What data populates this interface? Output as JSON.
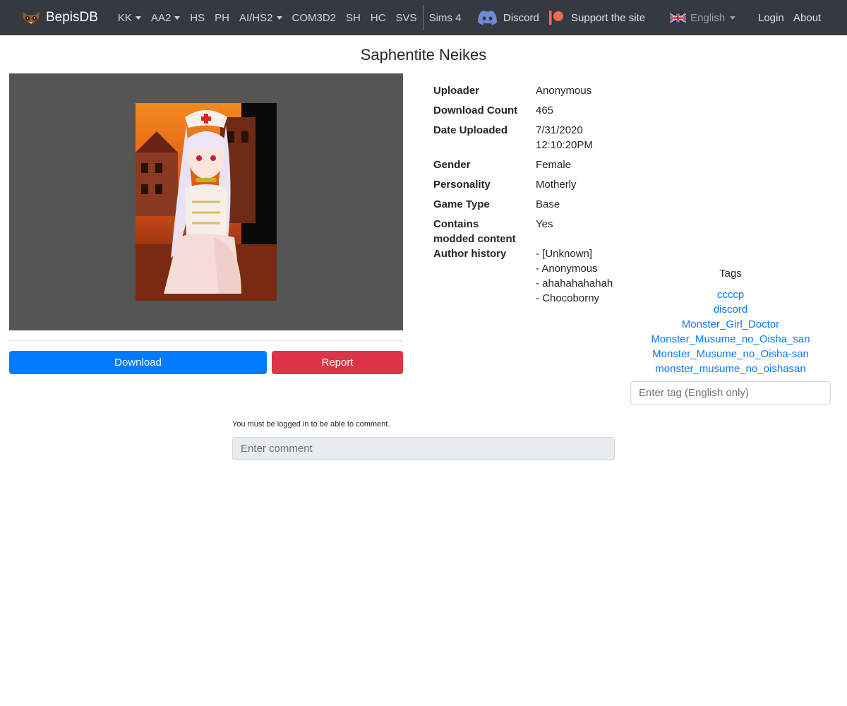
{
  "navbar": {
    "brand": "BepisDB",
    "items": [
      {
        "label": "KK",
        "dropdown": true
      },
      {
        "label": "AA2",
        "dropdown": true
      },
      {
        "label": "HS",
        "dropdown": false
      },
      {
        "label": "PH",
        "dropdown": false
      },
      {
        "label": "AI/HS2",
        "dropdown": true
      },
      {
        "label": "COM3D2",
        "dropdown": false
      },
      {
        "label": "SH",
        "dropdown": false
      },
      {
        "label": "HC",
        "dropdown": false
      },
      {
        "label": "SVS",
        "dropdown": false
      }
    ],
    "sims": "Sims 4",
    "discord": "Discord",
    "support": "Support the site",
    "language": "English",
    "login": "Login",
    "about": "About"
  },
  "card": {
    "title": "Saphentite Neikes",
    "download_label": "Download",
    "report_label": "Report"
  },
  "info": {
    "uploader": {
      "key": "Uploader",
      "value": "Anonymous"
    },
    "download_count": {
      "key": "Download Count",
      "value": "465"
    },
    "date_uploaded": {
      "key": "Date Uploaded",
      "value_line1": "7/31/2020",
      "value_line2": "12:10:20PM"
    },
    "gender": {
      "key": "Gender",
      "value": "Female"
    },
    "personality": {
      "key": "Personality",
      "value": "Motherly"
    },
    "game_type": {
      "key": "Game Type",
      "value": "Base"
    },
    "modded": {
      "key_line1": "Contains",
      "key_line2": "modded content",
      "value": "Yes"
    },
    "author_history": {
      "key": "Author history",
      "entries": [
        "- [Unknown]",
        "- Anonymous",
        "- ahahahahahah",
        "- Chocoborny"
      ]
    }
  },
  "tags": {
    "title": "Tags",
    "items": [
      "ccccp",
      "discord",
      "Monster_Girl_Doctor",
      "Monster_Musume_no_Oisha_san",
      "Monster_Musume_no_Oisha-san",
      "monster_musume_no_oishasan"
    ],
    "input_placeholder": "Enter tag (English only)"
  },
  "comments": {
    "note": "You must be logged in to be able to comment.",
    "input_placeholder": "Enter comment"
  },
  "colors": {
    "navbar_bg": "#343a40",
    "primary": "#007bff",
    "danger": "#dc3545",
    "preview_bg": "#555555"
  }
}
